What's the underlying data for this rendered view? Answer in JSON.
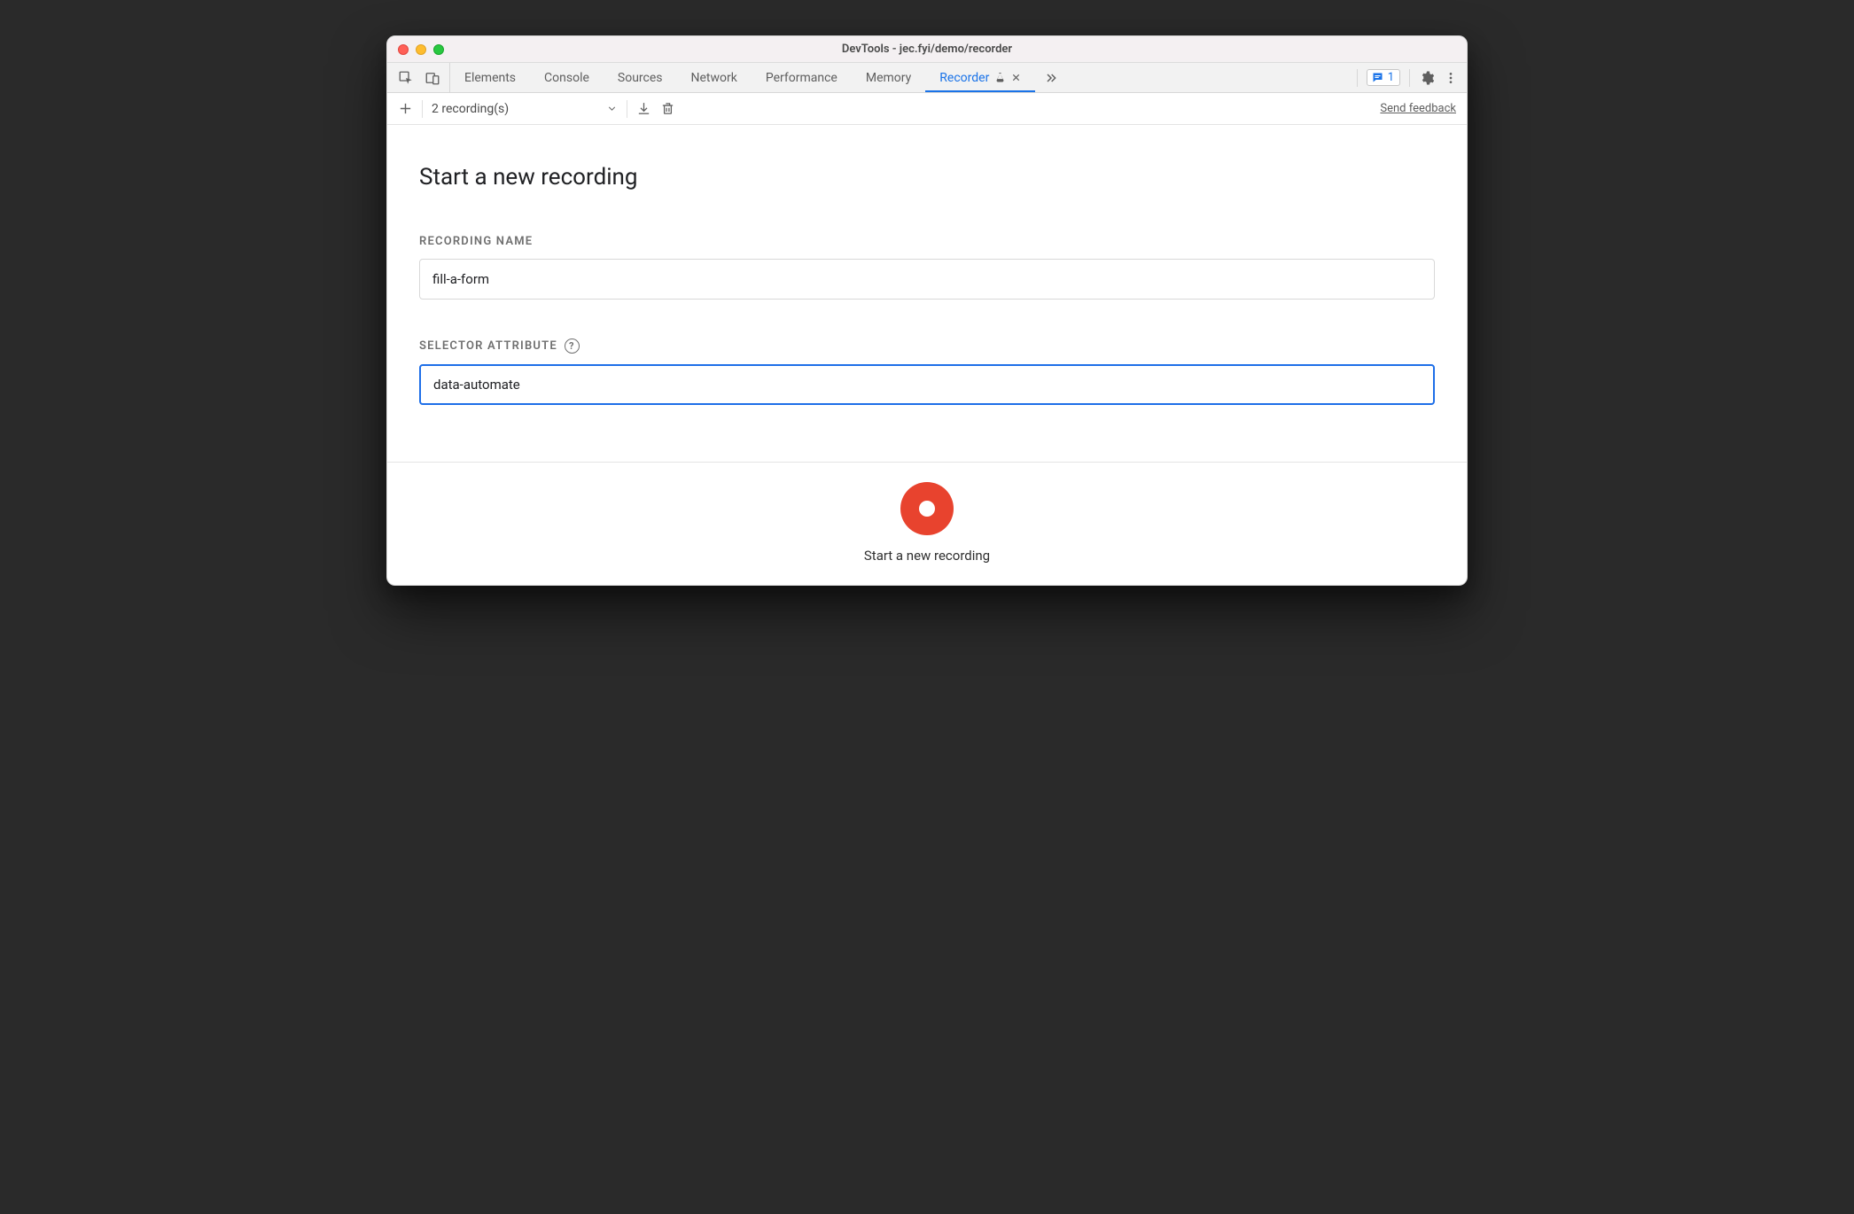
{
  "window": {
    "title": "DevTools - jec.fyi/demo/recorder"
  },
  "tabs": {
    "items": [
      {
        "label": "Elements"
      },
      {
        "label": "Console"
      },
      {
        "label": "Sources"
      },
      {
        "label": "Network"
      },
      {
        "label": "Performance"
      },
      {
        "label": "Memory"
      },
      {
        "label": "Recorder",
        "active": true,
        "experimental": true,
        "closable": true
      }
    ],
    "issues_count": "1"
  },
  "toolbar": {
    "recordings_label": "2 recording(s)",
    "send_feedback": "Send feedback"
  },
  "form": {
    "heading": "Start a new recording",
    "recording_name_label": "RECORDING NAME",
    "recording_name_value": "fill-a-form",
    "selector_attr_label": "SELECTOR ATTRIBUTE",
    "selector_attr_value": "data-automate"
  },
  "footer": {
    "record_caption": "Start a new recording"
  }
}
